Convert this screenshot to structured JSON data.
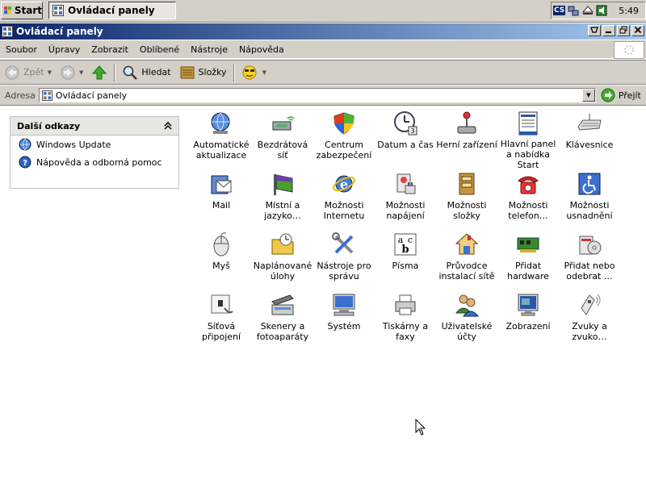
{
  "taskbar": {
    "start_label": "Start",
    "task_label": "Ovládací panely",
    "lang": "CS",
    "clock": "5:49"
  },
  "window": {
    "title": "Ovládací panely"
  },
  "menu": [
    "Soubor",
    "Úpravy",
    "Zobrazit",
    "Oblíbené",
    "Nástroje",
    "Nápověda"
  ],
  "toolbar": {
    "back_label": "Zpět",
    "search_label": "Hledat",
    "folders_label": "Složky"
  },
  "address": {
    "label": "Adresa",
    "value": "Ovládací panely",
    "go_label": "Přejít"
  },
  "sidebar": {
    "title": "Další odkazy",
    "links": [
      "Windows Update",
      "Nápověda a odborná pomoc"
    ]
  },
  "items": [
    {
      "label": "Automatické aktualizace",
      "icon": "globe-update-icon"
    },
    {
      "label": "Bezdrátová síť",
      "icon": "wireless-icon"
    },
    {
      "label": "Centrum zabezpečení",
      "icon": "shield-icon"
    },
    {
      "label": "Datum a čas",
      "icon": "clock-icon"
    },
    {
      "label": "Herní zařízení",
      "icon": "joystick-icon"
    },
    {
      "label": "Hlavní panel a nabídka Start",
      "icon": "taskbar-icon"
    },
    {
      "label": "Klávesnice",
      "icon": "keyboard-icon"
    },
    {
      "label": "Mail",
      "icon": "mail-icon"
    },
    {
      "label": "Místní a jazyko…",
      "icon": "globe-flag-icon"
    },
    {
      "label": "Možnosti Internetu",
      "icon": "internet-icon"
    },
    {
      "label": "Možnosti napájení",
      "icon": "power-icon"
    },
    {
      "label": "Možnosti složky",
      "icon": "folder-options-icon"
    },
    {
      "label": "Možnosti telefon…",
      "icon": "phone-icon"
    },
    {
      "label": "Možnosti usnadnění",
      "icon": "accessibility-icon"
    },
    {
      "label": "Myš",
      "icon": "mouse-icon"
    },
    {
      "label": "Naplánované úlohy",
      "icon": "scheduled-tasks-icon"
    },
    {
      "label": "Nástroje pro správu",
      "icon": "tools-icon"
    },
    {
      "label": "Písma",
      "icon": "fonts-icon"
    },
    {
      "label": "Průvodce instalací sítě",
      "icon": "network-wizard-icon"
    },
    {
      "label": "Přidat hardware",
      "icon": "hardware-icon"
    },
    {
      "label": "Přidat nebo odebrat …",
      "icon": "add-remove-icon"
    },
    {
      "label": "Síťová připojení",
      "icon": "network-connections-icon"
    },
    {
      "label": "Skenery a fotoaparáty",
      "icon": "scanner-icon"
    },
    {
      "label": "Systém",
      "icon": "system-icon"
    },
    {
      "label": "Tiskárny a faxy",
      "icon": "printer-icon"
    },
    {
      "label": "Uživatelské účty",
      "icon": "users-icon"
    },
    {
      "label": "Zobrazení",
      "icon": "display-icon"
    },
    {
      "label": "Zvuky a zvuko…",
      "icon": "sounds-icon"
    }
  ]
}
